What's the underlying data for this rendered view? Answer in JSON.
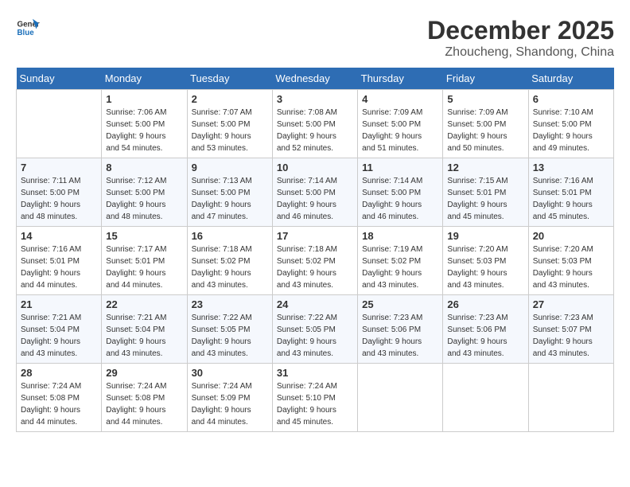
{
  "header": {
    "logo_line1": "General",
    "logo_line2": "Blue",
    "month": "December 2025",
    "location": "Zhoucheng, Shandong, China"
  },
  "weekdays": [
    "Sunday",
    "Monday",
    "Tuesday",
    "Wednesday",
    "Thursday",
    "Friday",
    "Saturday"
  ],
  "weeks": [
    [
      {
        "day": "",
        "info": ""
      },
      {
        "day": "1",
        "info": "Sunrise: 7:06 AM\nSunset: 5:00 PM\nDaylight: 9 hours\nand 54 minutes."
      },
      {
        "day": "2",
        "info": "Sunrise: 7:07 AM\nSunset: 5:00 PM\nDaylight: 9 hours\nand 53 minutes."
      },
      {
        "day": "3",
        "info": "Sunrise: 7:08 AM\nSunset: 5:00 PM\nDaylight: 9 hours\nand 52 minutes."
      },
      {
        "day": "4",
        "info": "Sunrise: 7:09 AM\nSunset: 5:00 PM\nDaylight: 9 hours\nand 51 minutes."
      },
      {
        "day": "5",
        "info": "Sunrise: 7:09 AM\nSunset: 5:00 PM\nDaylight: 9 hours\nand 50 minutes."
      },
      {
        "day": "6",
        "info": "Sunrise: 7:10 AM\nSunset: 5:00 PM\nDaylight: 9 hours\nand 49 minutes."
      }
    ],
    [
      {
        "day": "7",
        "info": "Sunrise: 7:11 AM\nSunset: 5:00 PM\nDaylight: 9 hours\nand 48 minutes."
      },
      {
        "day": "8",
        "info": "Sunrise: 7:12 AM\nSunset: 5:00 PM\nDaylight: 9 hours\nand 48 minutes."
      },
      {
        "day": "9",
        "info": "Sunrise: 7:13 AM\nSunset: 5:00 PM\nDaylight: 9 hours\nand 47 minutes."
      },
      {
        "day": "10",
        "info": "Sunrise: 7:14 AM\nSunset: 5:00 PM\nDaylight: 9 hours\nand 46 minutes."
      },
      {
        "day": "11",
        "info": "Sunrise: 7:14 AM\nSunset: 5:00 PM\nDaylight: 9 hours\nand 46 minutes."
      },
      {
        "day": "12",
        "info": "Sunrise: 7:15 AM\nSunset: 5:01 PM\nDaylight: 9 hours\nand 45 minutes."
      },
      {
        "day": "13",
        "info": "Sunrise: 7:16 AM\nSunset: 5:01 PM\nDaylight: 9 hours\nand 45 minutes."
      }
    ],
    [
      {
        "day": "14",
        "info": "Sunrise: 7:16 AM\nSunset: 5:01 PM\nDaylight: 9 hours\nand 44 minutes."
      },
      {
        "day": "15",
        "info": "Sunrise: 7:17 AM\nSunset: 5:01 PM\nDaylight: 9 hours\nand 44 minutes."
      },
      {
        "day": "16",
        "info": "Sunrise: 7:18 AM\nSunset: 5:02 PM\nDaylight: 9 hours\nand 43 minutes."
      },
      {
        "day": "17",
        "info": "Sunrise: 7:18 AM\nSunset: 5:02 PM\nDaylight: 9 hours\nand 43 minutes."
      },
      {
        "day": "18",
        "info": "Sunrise: 7:19 AM\nSunset: 5:02 PM\nDaylight: 9 hours\nand 43 minutes."
      },
      {
        "day": "19",
        "info": "Sunrise: 7:20 AM\nSunset: 5:03 PM\nDaylight: 9 hours\nand 43 minutes."
      },
      {
        "day": "20",
        "info": "Sunrise: 7:20 AM\nSunset: 5:03 PM\nDaylight: 9 hours\nand 43 minutes."
      }
    ],
    [
      {
        "day": "21",
        "info": "Sunrise: 7:21 AM\nSunset: 5:04 PM\nDaylight: 9 hours\nand 43 minutes."
      },
      {
        "day": "22",
        "info": "Sunrise: 7:21 AM\nSunset: 5:04 PM\nDaylight: 9 hours\nand 43 minutes."
      },
      {
        "day": "23",
        "info": "Sunrise: 7:22 AM\nSunset: 5:05 PM\nDaylight: 9 hours\nand 43 minutes."
      },
      {
        "day": "24",
        "info": "Sunrise: 7:22 AM\nSunset: 5:05 PM\nDaylight: 9 hours\nand 43 minutes."
      },
      {
        "day": "25",
        "info": "Sunrise: 7:23 AM\nSunset: 5:06 PM\nDaylight: 9 hours\nand 43 minutes."
      },
      {
        "day": "26",
        "info": "Sunrise: 7:23 AM\nSunset: 5:06 PM\nDaylight: 9 hours\nand 43 minutes."
      },
      {
        "day": "27",
        "info": "Sunrise: 7:23 AM\nSunset: 5:07 PM\nDaylight: 9 hours\nand 43 minutes."
      }
    ],
    [
      {
        "day": "28",
        "info": "Sunrise: 7:24 AM\nSunset: 5:08 PM\nDaylight: 9 hours\nand 44 minutes."
      },
      {
        "day": "29",
        "info": "Sunrise: 7:24 AM\nSunset: 5:08 PM\nDaylight: 9 hours\nand 44 minutes."
      },
      {
        "day": "30",
        "info": "Sunrise: 7:24 AM\nSunset: 5:09 PM\nDaylight: 9 hours\nand 44 minutes."
      },
      {
        "day": "31",
        "info": "Sunrise: 7:24 AM\nSunset: 5:10 PM\nDaylight: 9 hours\nand 45 minutes."
      },
      {
        "day": "",
        "info": ""
      },
      {
        "day": "",
        "info": ""
      },
      {
        "day": "",
        "info": ""
      }
    ]
  ]
}
